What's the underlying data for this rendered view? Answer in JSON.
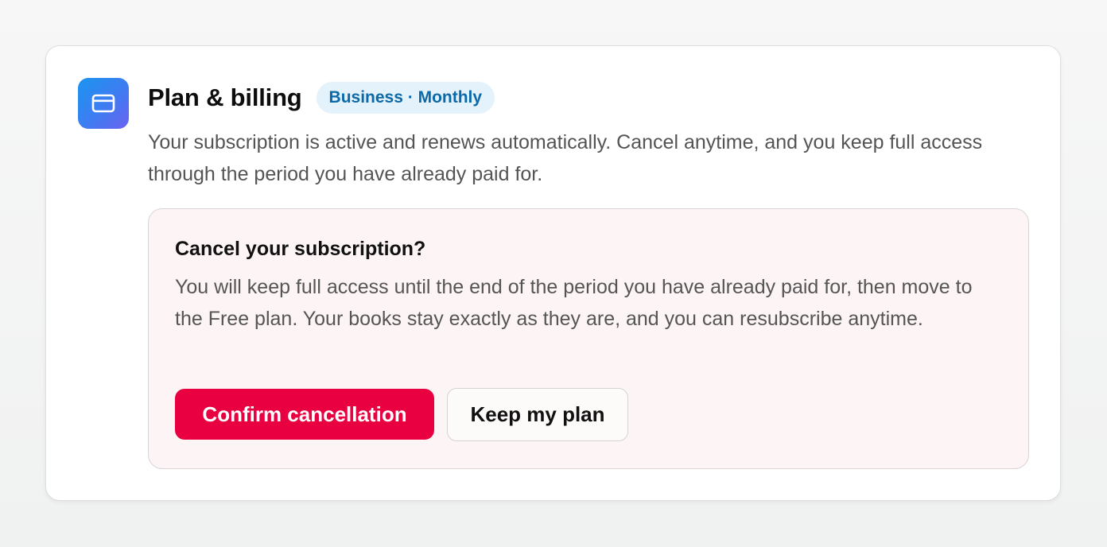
{
  "card": {
    "icon": "credit-card-icon",
    "title": "Plan & billing",
    "badge": "Business · Monthly",
    "description": "Your subscription is active and renews automatically. Cancel anytime, and you keep full access through the period you have already paid for."
  },
  "cancel_panel": {
    "title": "Cancel your subscription?",
    "text": "You will keep full access until the end of the period you have already paid for, then move to the Free plan. Your books stay exactly as they are, and you can resubscribe anytime.",
    "confirm_label": "Confirm cancellation",
    "keep_label": "Keep my plan"
  },
  "colors": {
    "accent_gradient_start": "#1a95ef",
    "accent_gradient_end": "#6a61ef",
    "badge_bg": "#e4f2fb",
    "badge_text": "#0a69a8",
    "danger": "#e80041",
    "panel_bg": "#fdf4f5"
  }
}
